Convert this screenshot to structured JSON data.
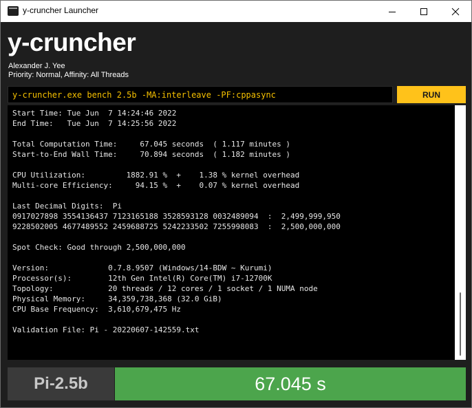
{
  "window": {
    "title": "y-cruncher Launcher",
    "icon": "terminal-icon"
  },
  "header": {
    "app_title": "y-cruncher",
    "author": "Alexander J. Yee",
    "priority": "Priority: Normal, Affinity: All Threads"
  },
  "command": {
    "value": "y-cruncher.exe bench 2.5b -MA:interleave -PF:cppasync",
    "run_label": "RUN"
  },
  "output": {
    "lines": [
      "Start Time: Tue Jun  7 14:24:46 2022",
      "End Time:   Tue Jun  7 14:25:56 2022",
      "",
      "Total Computation Time:     67.045 seconds  ( 1.117 minutes )",
      "Start-to-End Wall Time:     70.894 seconds  ( 1.182 minutes )",
      "",
      "CPU Utilization:         1882.91 %  +    1.38 % kernel overhead",
      "Multi-core Efficiency:     94.15 %  +    0.07 % kernel overhead",
      "",
      "Last Decimal Digits:  Pi",
      "0917027898 3554136437 7123165188 3528593128 0032489094  :  2,499,999,950",
      "9228502005 4677489552 2459688725 5242233502 7255998083  :  2,500,000,000",
      "",
      "Spot Check: Good through 2,500,000,000",
      "",
      "Version:             0.7.8.9507 (Windows/14-BDW ~ Kurumi)",
      "Processor(s):        12th Gen Intel(R) Core(TM) i7-12700K",
      "Topology:            20 threads / 12 cores / 1 socket / 1 NUMA node",
      "Physical Memory:     34,359,738,368 (32.0 GiB)",
      "CPU Base Frequency:  3,610,679,475 Hz",
      "",
      "Validation File: Pi - 20220607-142559.txt"
    ]
  },
  "footer": {
    "benchmark_label": "Pi-2.5b",
    "result": "67.045 s"
  },
  "colors": {
    "accent_yellow": "#ffc21a",
    "command_text": "#f5c000",
    "result_green": "#4ca54c",
    "background": "#1e1e1e"
  }
}
